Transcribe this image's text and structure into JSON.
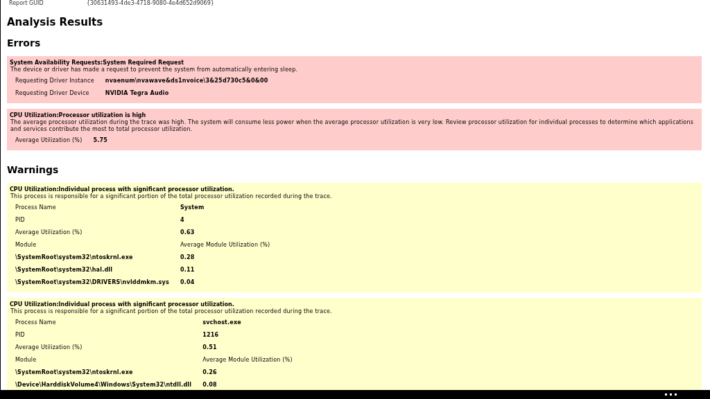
{
  "report_guid": {
    "label": "Report GUID",
    "value": "{30631493-4de3-4718-9080-4e4d652d9069}"
  },
  "title": "Analysis Results",
  "sections": [
    {
      "heading": "Errors",
      "kind": "error",
      "items": [
        {
          "title": "System Availability Requests:System Required Request",
          "description": "The device or driver has made a request to prevent the system from automatically entering sleep.",
          "rows": [
            {
              "kind": "field",
              "label": "Requesting Driver Instance",
              "value": "nvaenum\\nvawave&ds1nvoice\\3&25d730c5&0&00"
            },
            {
              "kind": "field",
              "label": "Requesting Driver Device",
              "value": "NVIDIA Tegra Audio"
            }
          ]
        },
        {
          "title": "CPU Utilization:Processor utilization is high",
          "description": "The average processor utilization during the trace was high. The system will consume less power when the average processor utilization is very low. Review processor utilization for individual processes to determine which applications and services contribute the most to total processor utilization.",
          "rows": [
            {
              "kind": "field",
              "label": "Average Utilization (%)",
              "value": "5.75"
            }
          ]
        }
      ]
    },
    {
      "heading": "Warnings",
      "kind": "warning",
      "items": [
        {
          "title": "CPU Utilization:Individual process with significant processor utilization.",
          "description": "This process is responsible for a significant portion of the total processor utilization recorded during the trace.",
          "rows": [
            {
              "kind": "field",
              "label": "Process Name",
              "value": "System"
            },
            {
              "kind": "field",
              "label": "PID",
              "value": "4"
            },
            {
              "kind": "field",
              "label": "Average Utilization (%)",
              "value": "0.63"
            },
            {
              "kind": "header",
              "label": "Module",
              "value": "Average Module Utilization (%)"
            },
            {
              "kind": "module",
              "label": "\\SystemRoot\\system32\\ntoskrnl.exe",
              "value": "0.28"
            },
            {
              "kind": "module",
              "label": "\\SystemRoot\\system32\\hal.dll",
              "value": "0.11"
            },
            {
              "kind": "module",
              "label": "\\SystemRoot\\system32\\DRIVERS\\nvlddmkm.sys",
              "value": "0.04"
            }
          ]
        },
        {
          "title": "CPU Utilization:Individual process with significant processor utilization.",
          "description": "This process is responsible for a significant portion of the total processor utilization recorded during the trace.",
          "rows": [
            {
              "kind": "field",
              "label": "Process Name",
              "value": "svchost.exe"
            },
            {
              "kind": "field",
              "label": "PID",
              "value": "1216"
            },
            {
              "kind": "field",
              "label": "Average Utilization (%)",
              "value": "0.51"
            },
            {
              "kind": "header",
              "label": "Module",
              "value": "Average Module Utilization (%)"
            },
            {
              "kind": "module",
              "label": "\\SystemRoot\\system32\\ntoskrnl.exe",
              "value": "0.26"
            },
            {
              "kind": "module",
              "label": "\\Device\\HarddiskVolume4\\Windows\\System32\\ntdll.dll",
              "value": "0.08"
            }
          ]
        }
      ]
    }
  ]
}
